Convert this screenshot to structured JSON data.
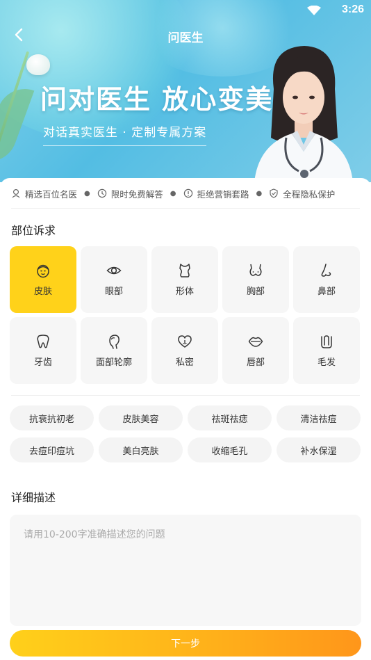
{
  "status_bar": {
    "time": "3:26"
  },
  "nav": {
    "title": "问医生"
  },
  "banner": {
    "headline": "问对医生 放心变美",
    "subline": "对话真实医生 · 定制专属方案"
  },
  "features": [
    {
      "icon": "doctor-badge-icon",
      "label": "精选百位名医"
    },
    {
      "icon": "clock-icon",
      "label": "限时免费解答"
    },
    {
      "icon": "info-circle-icon",
      "label": "拒绝营销套路"
    },
    {
      "icon": "shield-check-icon",
      "label": "全程隐私保护"
    }
  ],
  "body_parts": {
    "title": "部位诉求",
    "selected": "皮肤",
    "items": [
      {
        "label": "皮肤",
        "icon": "face-smile-icon"
      },
      {
        "label": "眼部",
        "icon": "eye-icon"
      },
      {
        "label": "形体",
        "icon": "torso-icon"
      },
      {
        "label": "胸部",
        "icon": "chest-icon"
      },
      {
        "label": "鼻部",
        "icon": "nose-icon"
      },
      {
        "label": "牙齿",
        "icon": "tooth-icon"
      },
      {
        "label": "面部轮廓",
        "icon": "face-profile-icon"
      },
      {
        "label": "私密",
        "icon": "heart-icon"
      },
      {
        "label": "唇部",
        "icon": "lips-icon"
      },
      {
        "label": "毛发",
        "icon": "hair-icon"
      }
    ]
  },
  "tags": [
    "抗衰抗初老",
    "皮肤美容",
    "祛斑祛痣",
    "清洁祛痘",
    "去痘印痘坑",
    "美白亮肤",
    "收缩毛孔",
    "补水保湿"
  ],
  "description": {
    "title": "详细描述",
    "placeholder": "请用10-200字准确描述您的问题"
  },
  "next_button": {
    "label": "下一步"
  },
  "colors": {
    "accent": "#ffd21a",
    "button_gradient_start": "#ffd01a",
    "button_gradient_end": "#ff961a",
    "banner_blue": "#53bde3"
  }
}
